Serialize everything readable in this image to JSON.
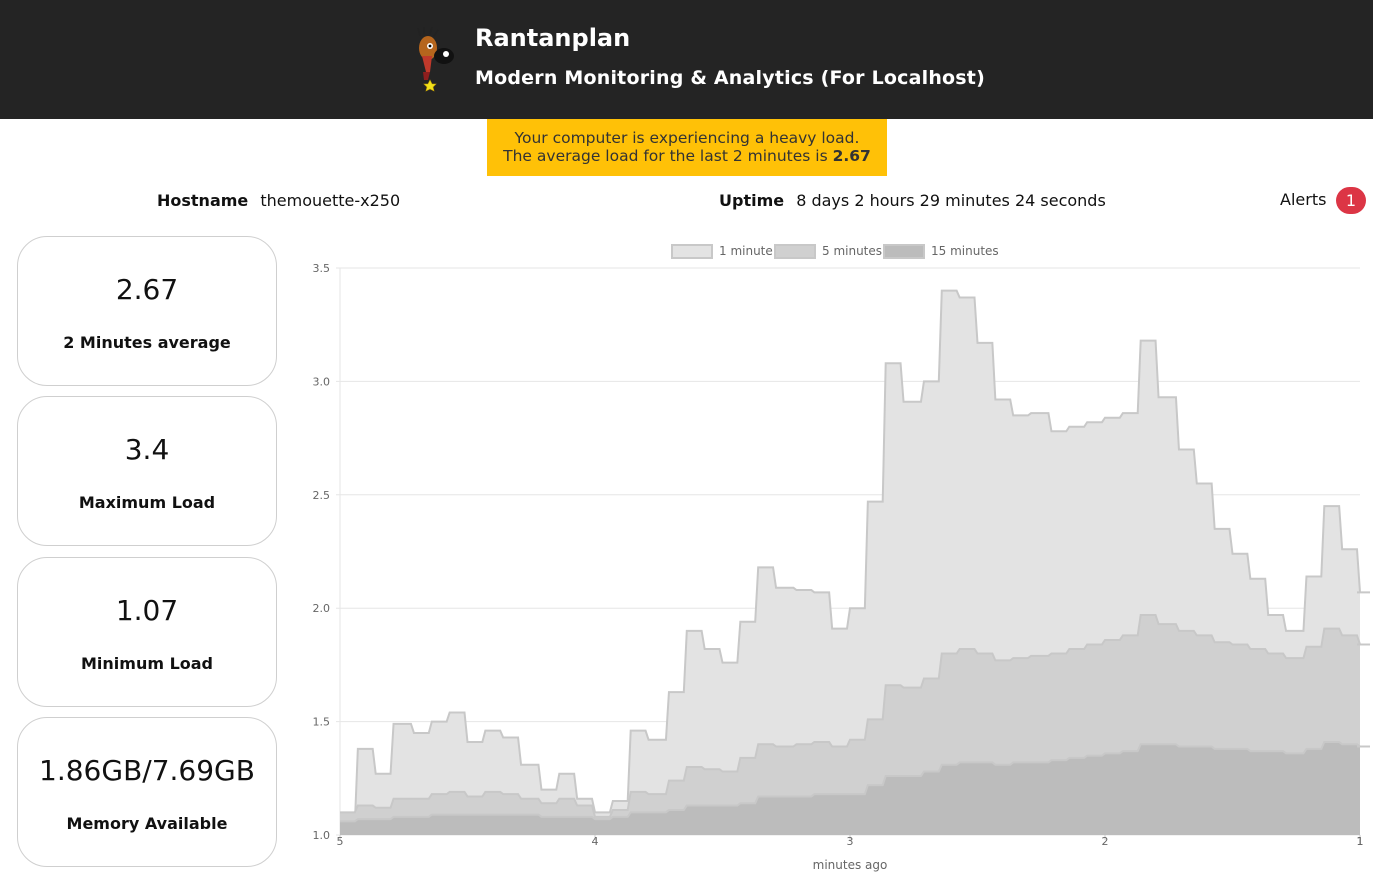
{
  "header": {
    "title": "Rantanplan",
    "subtitle": "Modern Monitoring & Analytics (For Localhost)",
    "logo_icon": "dog-logo-icon"
  },
  "alert_banner": {
    "line1": "Your computer is experiencing a heavy load.",
    "line2_prefix": "The average load for the last 2 minutes is ",
    "line2_value": "2.67",
    "color": "#ffc107"
  },
  "info": {
    "hostname_label": "Hostname",
    "hostname_value": "themouette-x250",
    "uptime_label": "Uptime",
    "uptime_value": "8 days 2 hours 29 minutes 24 seconds",
    "alerts_label": "Alerts",
    "alerts_count": "1",
    "alerts_color": "#dc3545"
  },
  "cards": [
    {
      "value": "2.67",
      "label": "2 Minutes average"
    },
    {
      "value": "3.4",
      "label": "Maximum Load"
    },
    {
      "value": "1.07",
      "label": "Minimum Load"
    },
    {
      "value": "1.86GB/7.69GB",
      "label": "Memory Available"
    }
  ],
  "chart_data": {
    "type": "area",
    "xlabel": "minutes ago",
    "ylabel": "",
    "ylim": [
      1.0,
      3.5
    ],
    "xlim": [
      5,
      1
    ],
    "yticks": [
      "1.0",
      "1.5",
      "2.0",
      "2.5",
      "3.0",
      "3.5"
    ],
    "xticks": [
      5,
      4,
      3,
      2,
      1,
      1
    ],
    "xtick_labels": [
      "5",
      "4",
      "3",
      "2",
      "1",
      "1"
    ],
    "grid": true,
    "legend_position": "top",
    "x": [
      5.0,
      4.93,
      4.86,
      4.79,
      4.71,
      4.64,
      4.57,
      4.5,
      4.43,
      4.36,
      4.29,
      4.21,
      4.14,
      4.07,
      4.0,
      3.93,
      3.86,
      3.79,
      3.71,
      3.64,
      3.57,
      3.5,
      3.43,
      3.36,
      3.29,
      3.21,
      3.14,
      3.07,
      3.0,
      2.93,
      2.86,
      2.79,
      2.71,
      2.64,
      2.57,
      2.5,
      2.43,
      2.36,
      2.29,
      2.21,
      2.14,
      2.07,
      2.0,
      1.93,
      1.86,
      1.79,
      1.71,
      1.64,
      1.57,
      1.5,
      1.43,
      1.36,
      1.29,
      1.21,
      1.14,
      1.07,
      1.0,
      0.93,
      0.86,
      0.79,
      0.71,
      0.64,
      0.57,
      0.5
    ],
    "series": [
      {
        "name": "1 minute",
        "color": "#e3e3e3",
        "values": [
          1.05,
          1.38,
          1.27,
          1.49,
          1.45,
          1.5,
          1.54,
          1.41,
          1.46,
          1.43,
          1.31,
          1.2,
          1.27,
          1.16,
          1.1,
          1.15,
          1.46,
          1.42,
          1.63,
          1.9,
          1.82,
          1.76,
          1.94,
          2.18,
          2.09,
          2.08,
          2.07,
          1.91,
          2.0,
          2.47,
          3.08,
          2.91,
          3.0,
          3.4,
          3.37,
          3.17,
          2.92,
          2.85,
          2.86,
          2.78,
          2.8,
          2.82,
          2.84,
          2.86,
          3.18,
          2.93,
          2.7,
          2.55,
          2.35,
          2.24,
          2.13,
          1.97,
          1.9,
          2.14,
          2.45,
          2.26,
          2.07,
          2.07,
          2.07,
          2.07,
          2.07,
          2.07,
          2.07,
          2.07
        ]
      },
      {
        "name": "5 minutes",
        "color": "#d0d0d0",
        "values": [
          1.1,
          1.13,
          1.12,
          1.16,
          1.16,
          1.18,
          1.19,
          1.17,
          1.19,
          1.18,
          1.16,
          1.14,
          1.16,
          1.13,
          1.08,
          1.11,
          1.19,
          1.18,
          1.24,
          1.3,
          1.29,
          1.28,
          1.34,
          1.4,
          1.39,
          1.4,
          1.41,
          1.39,
          1.42,
          1.51,
          1.66,
          1.65,
          1.69,
          1.8,
          1.82,
          1.8,
          1.77,
          1.78,
          1.79,
          1.8,
          1.82,
          1.84,
          1.86,
          1.88,
          1.97,
          1.93,
          1.9,
          1.88,
          1.85,
          1.84,
          1.82,
          1.8,
          1.78,
          1.83,
          1.91,
          1.88,
          1.84,
          1.84,
          1.84,
          1.84,
          1.84,
          1.84,
          1.84,
          1.84
        ]
      },
      {
        "name": "15 minutes",
        "color": "#bcbcbc",
        "values": [
          1.06,
          1.07,
          1.07,
          1.08,
          1.08,
          1.09,
          1.09,
          1.09,
          1.09,
          1.09,
          1.09,
          1.08,
          1.08,
          1.08,
          1.07,
          1.08,
          1.1,
          1.1,
          1.11,
          1.13,
          1.13,
          1.13,
          1.14,
          1.17,
          1.17,
          1.17,
          1.18,
          1.18,
          1.18,
          1.22,
          1.26,
          1.26,
          1.28,
          1.31,
          1.32,
          1.32,
          1.31,
          1.32,
          1.32,
          1.33,
          1.34,
          1.35,
          1.36,
          1.37,
          1.4,
          1.4,
          1.39,
          1.39,
          1.38,
          1.38,
          1.37,
          1.37,
          1.36,
          1.38,
          1.41,
          1.4,
          1.39,
          1.39,
          1.39,
          1.39,
          1.39,
          1.39,
          1.39,
          1.39
        ]
      }
    ]
  }
}
